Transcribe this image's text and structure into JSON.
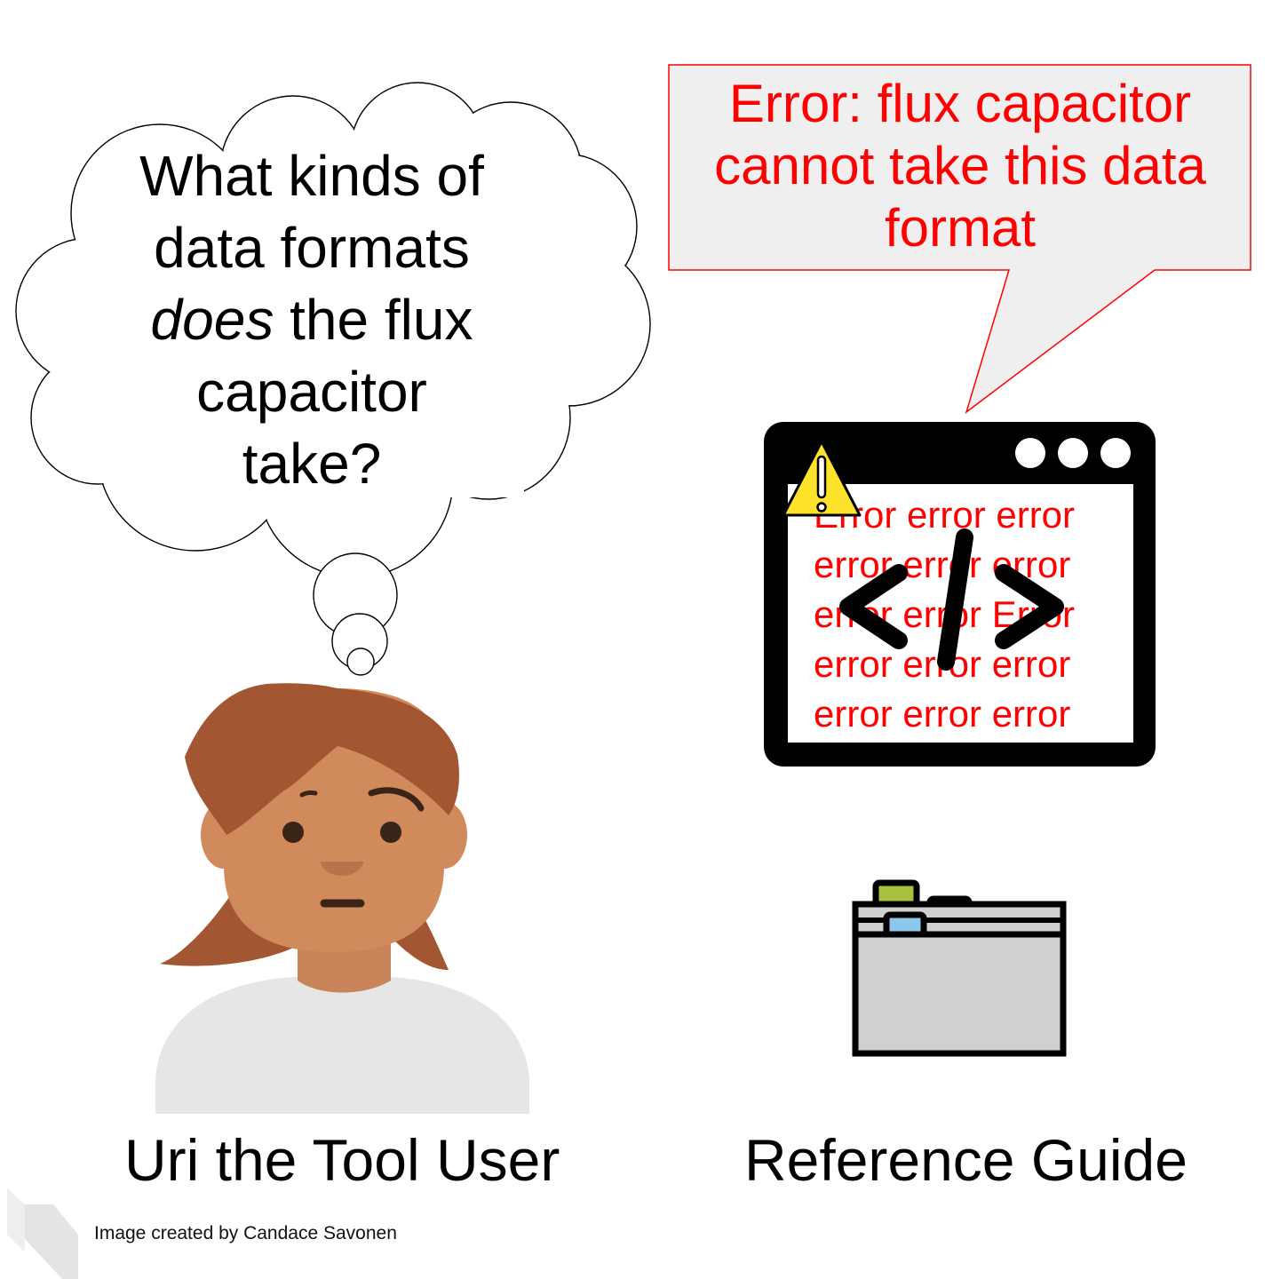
{
  "thought_bubble": {
    "line1": "What kinds of",
    "line2": "data formats",
    "line3_italic": "does",
    "line3_rest": " the flux",
    "line4": "capacitor",
    "line5": "take?"
  },
  "error_callout": {
    "text": "Error: flux capacitor cannot take this data format",
    "color": "#ff0000"
  },
  "code_window": {
    "lines": [
      "Error error error",
      "error error error",
      "error error Error",
      "error error error",
      "error error error"
    ],
    "tag_glyph": "</>",
    "warning_icon": "warning-triangle-icon"
  },
  "captions": {
    "user": "Uri the Tool User",
    "reference": "Reference Guide"
  },
  "credit": "Image created by Candace Savonen",
  "colors": {
    "hair": "#a35632",
    "skin": "#d08a5c",
    "shirt": "#e6e6e6",
    "error_red": "#ff0000",
    "warning_yellow": "#ffe22a",
    "tab_green": "#a8c13a",
    "tab_red": "#e2503f",
    "tab_blue": "#8dc8ec",
    "folder_gray": "#d0d0d0"
  }
}
